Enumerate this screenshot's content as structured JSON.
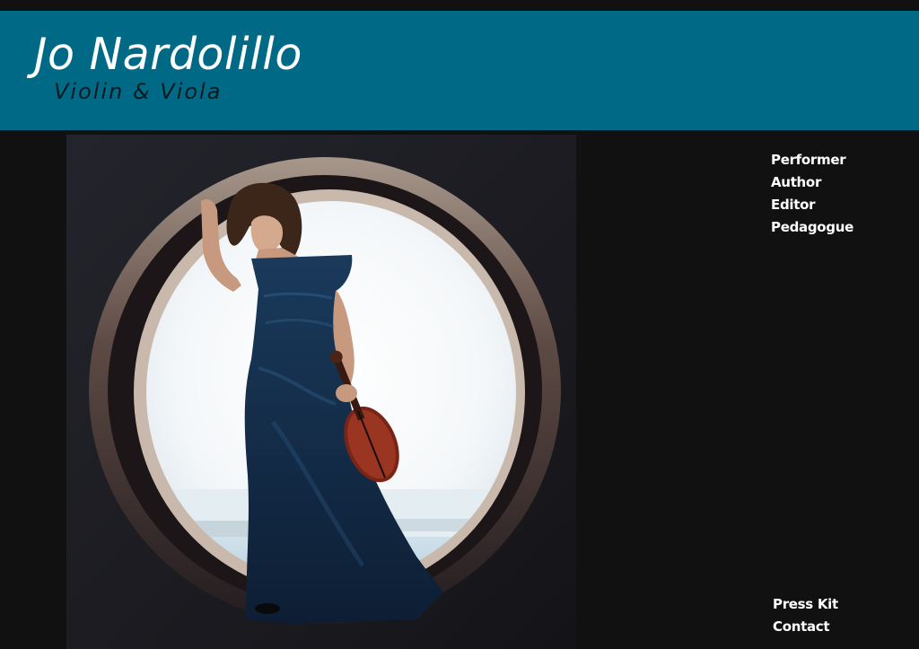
{
  "header": {
    "title": "Jo Nardolillo",
    "subtitle": "Violin & Viola"
  },
  "colors": {
    "header_bg": "#006a86",
    "page_bg": "#111111",
    "text": "#ffffff",
    "subtitle_text": "#0c1a20"
  },
  "hero": {
    "image": "photo of violinist in blue gown holding violin, framed in circular window"
  },
  "nav": {
    "primary": [
      {
        "label": "Performer"
      },
      {
        "label": "Author"
      },
      {
        "label": "Editor"
      },
      {
        "label": "Pedagogue"
      }
    ],
    "secondary": [
      {
        "label": "Press Kit"
      },
      {
        "label": "Contact"
      }
    ]
  }
}
